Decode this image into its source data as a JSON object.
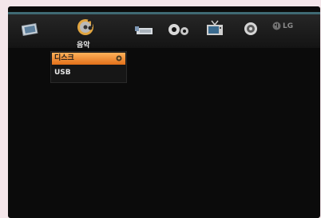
{
  "menu": {
    "active_label": "음악",
    "icons": [
      "photo-icon",
      "music-icon",
      "movie-icon",
      "settings-icon",
      "tv-icon",
      "disc-icon"
    ],
    "brand": "LG"
  },
  "submenu": {
    "items": [
      {
        "label": "디스크",
        "selected": true
      },
      {
        "label": "USB",
        "selected": false
      }
    ]
  },
  "colors": {
    "accent": "#f0912f",
    "topline": "#3f6a73",
    "background": "#0b0b0b"
  }
}
